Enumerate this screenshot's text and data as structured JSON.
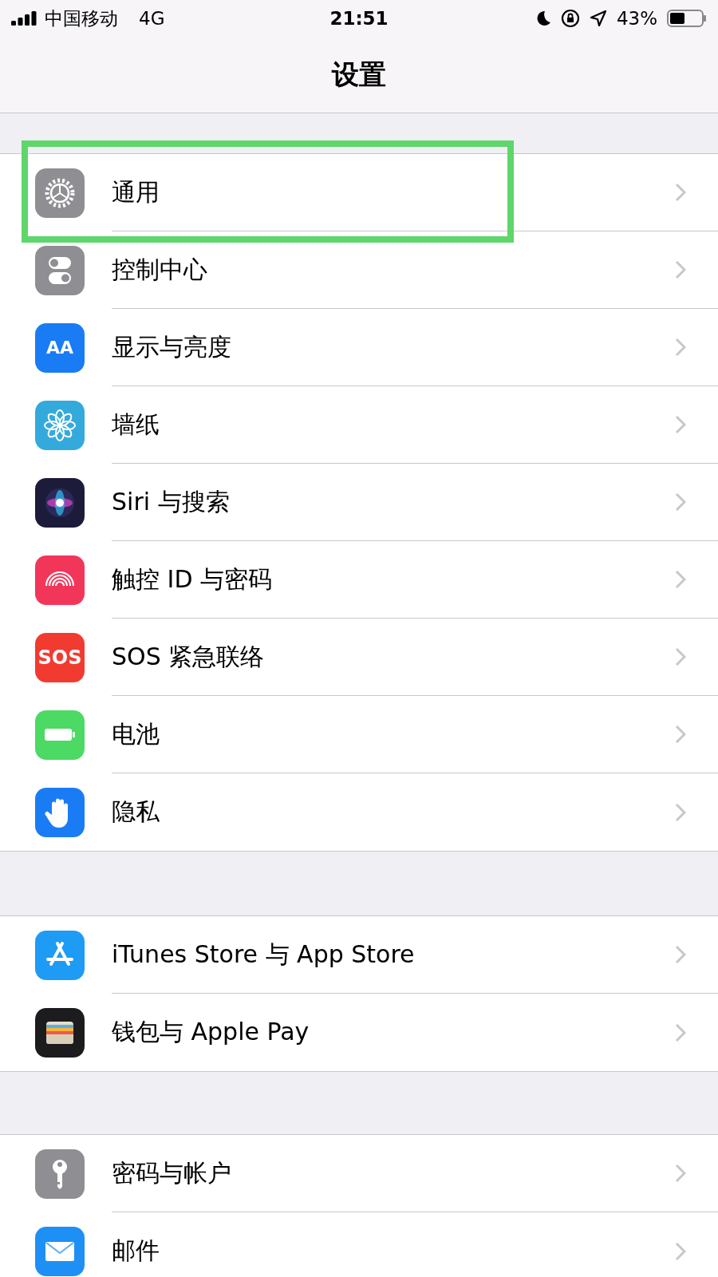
{
  "status_bar": {
    "carrier": "中国移动",
    "network": "4G",
    "time": "21:51",
    "battery": "43%"
  },
  "nav": {
    "title": "设置"
  },
  "groups": [
    {
      "items": [
        {
          "label": "通用",
          "kind": "gear",
          "color": "#8e8e93",
          "highlighted": true
        },
        {
          "label": "控制中心",
          "kind": "toggles",
          "color": "#8e8e93",
          "highlighted": false
        },
        {
          "label": "显示与亮度",
          "kind": "text",
          "icon_text": "AA",
          "color": "#1a7cf5",
          "highlighted": false
        },
        {
          "label": "墙纸",
          "kind": "flower",
          "color": "#34aadc",
          "highlighted": false
        },
        {
          "label": "Siri 与搜索",
          "kind": "orb",
          "color": "#1c1c3a",
          "highlighted": false
        },
        {
          "label": "触控 ID 与密码",
          "kind": "fingerprint",
          "color": "#f2365a",
          "highlighted": false
        },
        {
          "label": "SOS 紧急联络",
          "kind": "text",
          "icon_text": "SOS",
          "color": "#f23b30",
          "highlighted": false
        },
        {
          "label": "电池",
          "kind": "battery",
          "color": "#4cd964",
          "highlighted": false
        },
        {
          "label": "隐私",
          "kind": "hand",
          "color": "#1a7cf5",
          "highlighted": false
        }
      ]
    },
    {
      "items": [
        {
          "label": "iTunes Store 与 App Store",
          "kind": "appstore",
          "color": "#1e9bf5",
          "highlighted": false
        },
        {
          "label": "钱包与 Apple Pay",
          "kind": "wallet",
          "color": "#1c1c1e",
          "highlighted": false
        }
      ]
    },
    {
      "items": [
        {
          "label": "密码与帐户",
          "kind": "key",
          "color": "#8e8e93",
          "highlighted": false
        },
        {
          "label": "邮件",
          "kind": "mail",
          "color": "#1e90f5",
          "highlighted": false
        }
      ]
    }
  ]
}
